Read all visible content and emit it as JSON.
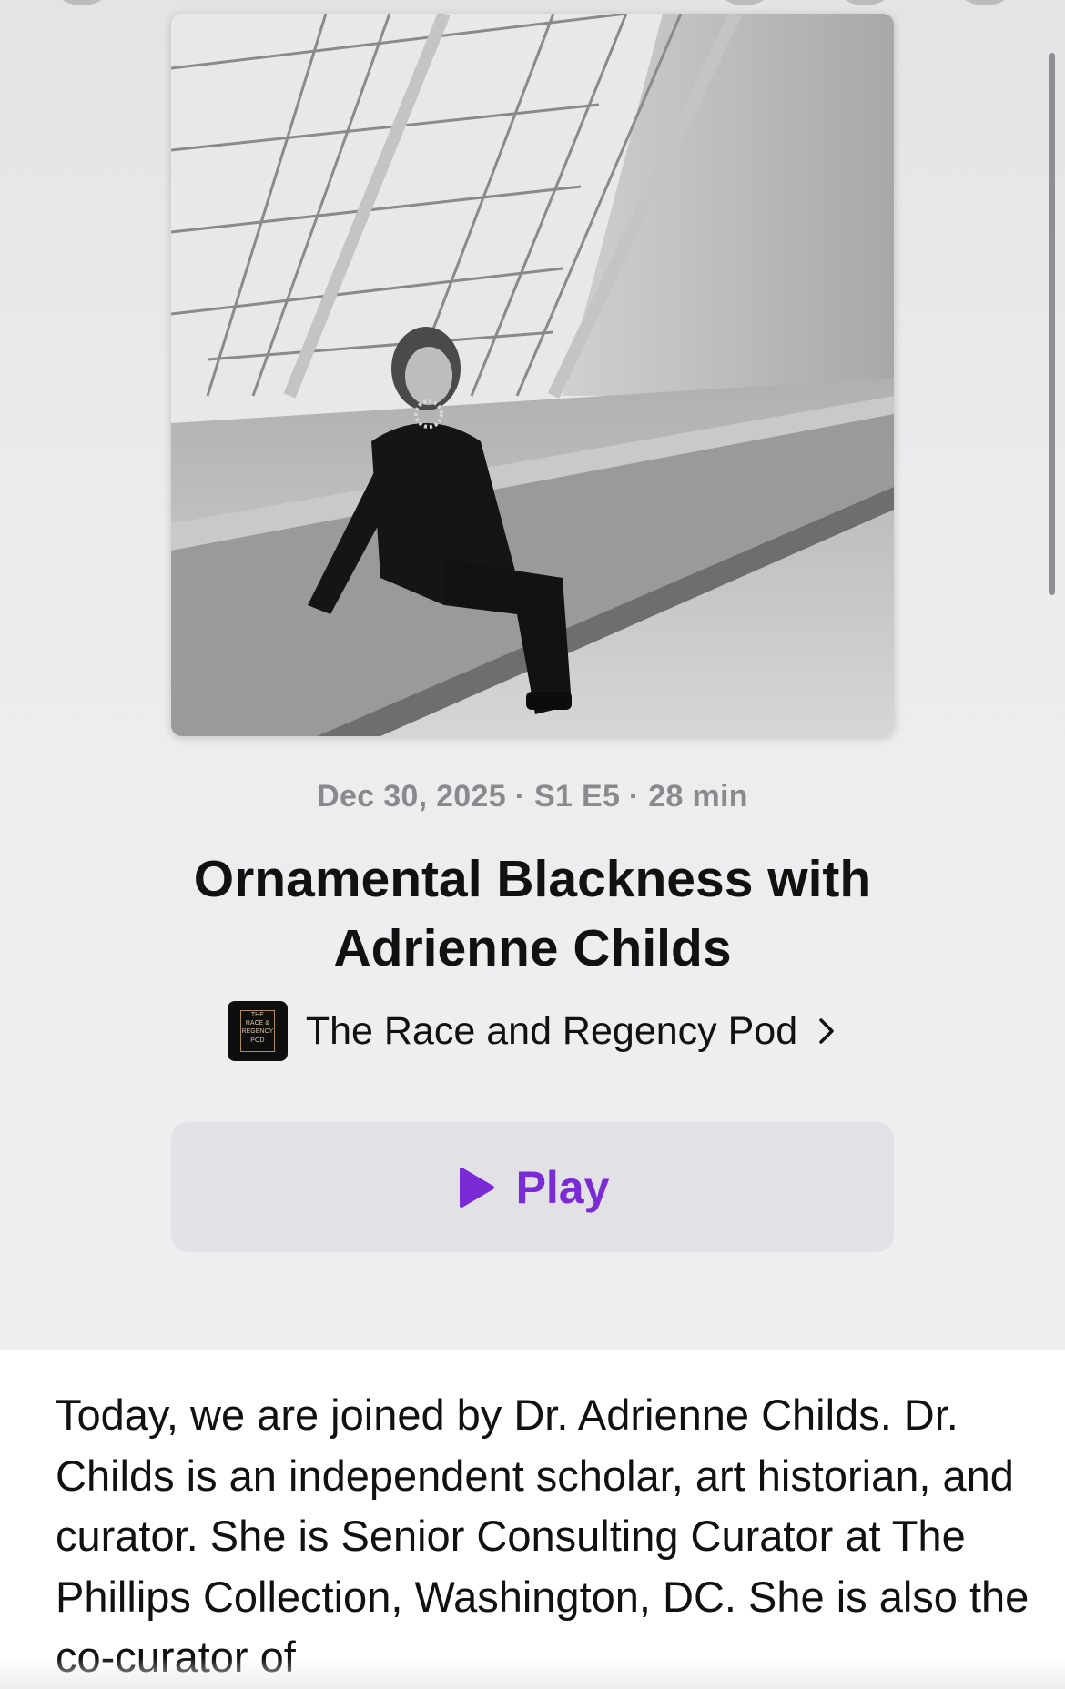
{
  "episode": {
    "meta": "Dec 30, 2025 · S1 E5 · 28 min",
    "title": "Ornamental Blackness with Adrienne Childs",
    "artwork_icon": "episode-artwork-photo"
  },
  "show": {
    "name": "The Race and Regency Pod",
    "thumb_lines": [
      "THE",
      "RACE &",
      "REGENCY",
      "POD"
    ],
    "chevron_icon": "chevron-right-icon"
  },
  "play": {
    "label": "Play",
    "icon": "play-icon",
    "accent_color": "#7a2bd6"
  },
  "description": {
    "text": "Today, we are joined by Dr. Adrienne Childs. Dr. Childs is an independent scholar, art historian, and curator. She is Senior Consulting Curator at The Phillips Collection, Washington, DC. She is also the co-curator of"
  }
}
